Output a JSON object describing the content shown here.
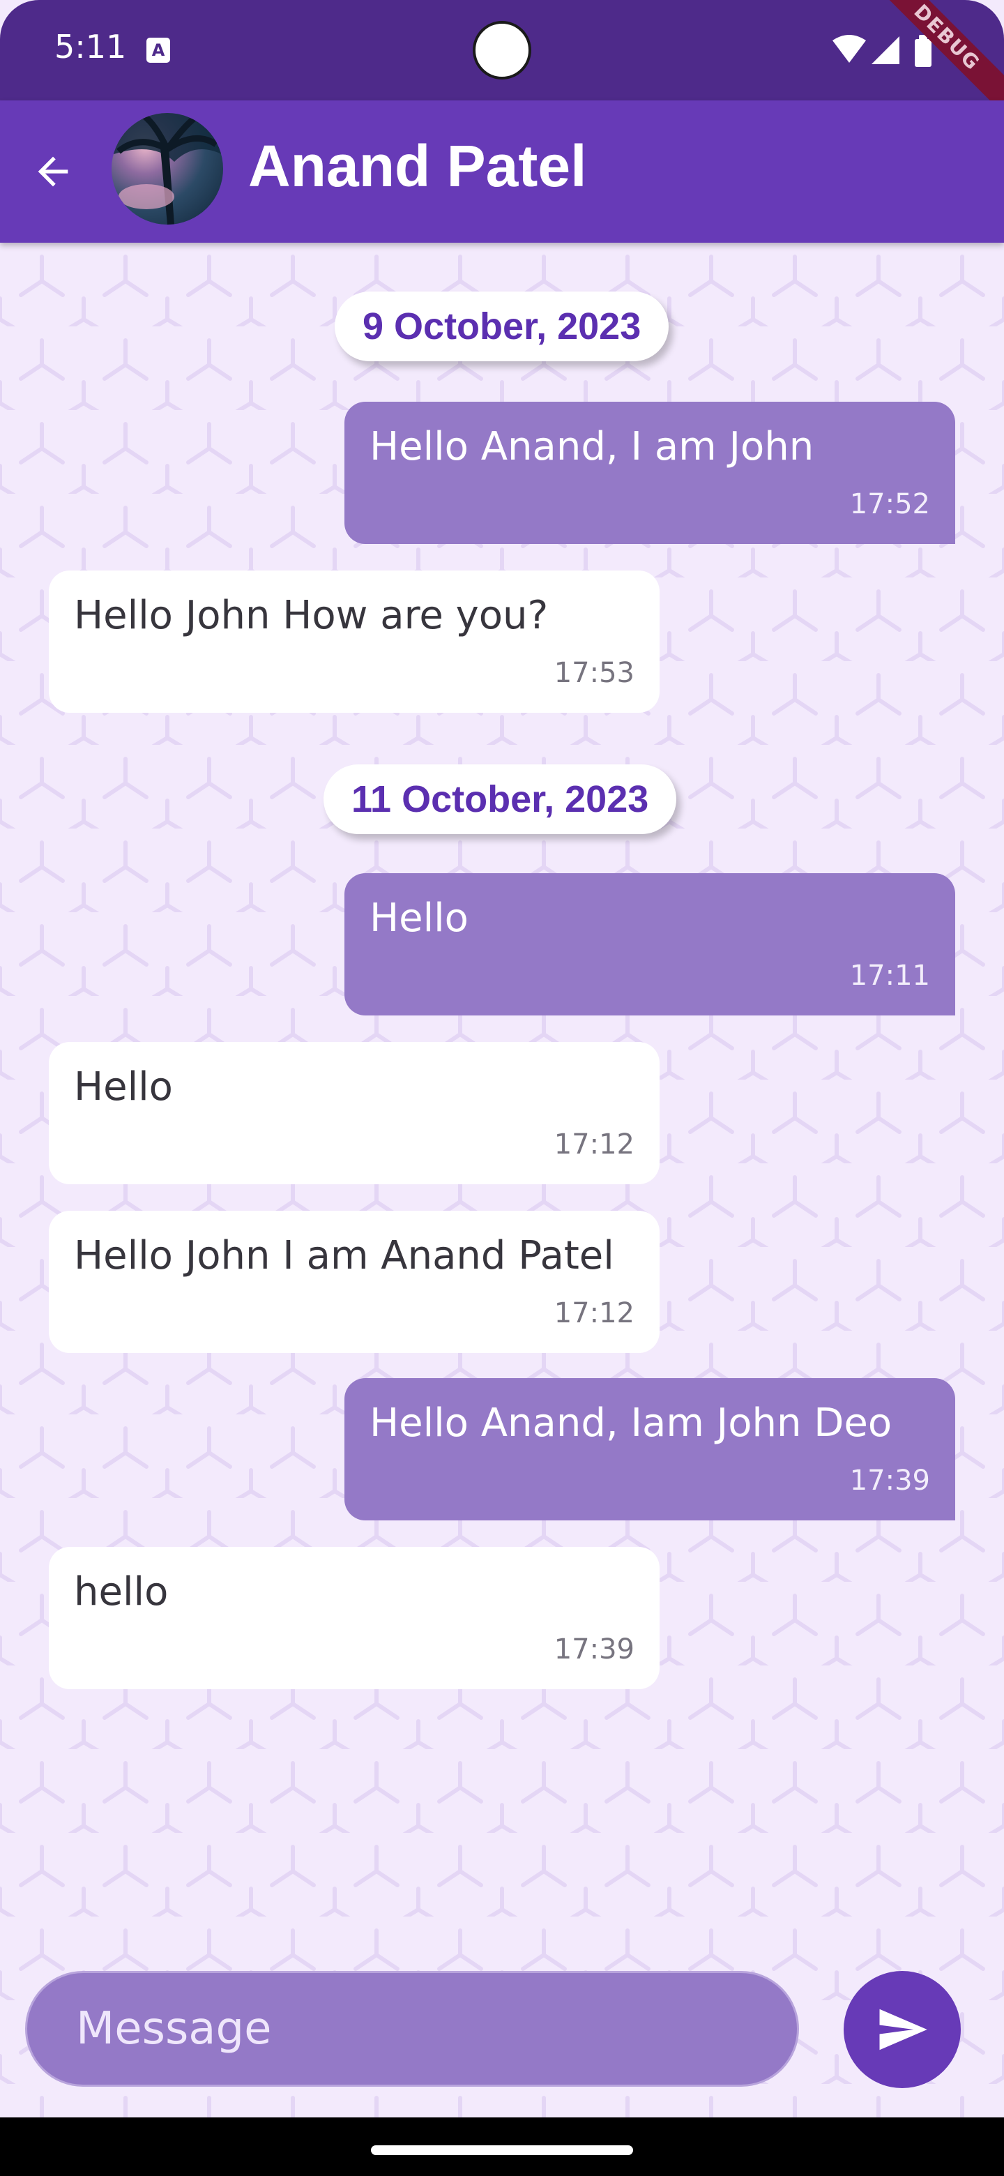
{
  "status_bar": {
    "time": "5:11",
    "icons": [
      "a-notification-icon",
      "wifi-icon",
      "signal-icon",
      "battery-icon"
    ],
    "debug_label": "DEBUG",
    "background": "#4e2a8a"
  },
  "app_bar": {
    "title": "Anand Patel",
    "background": "#673ab7"
  },
  "chat": {
    "dates": [
      "9 October, 2023",
      "11 October, 2023"
    ],
    "messages": [
      {
        "text": "Hello Anand, I am John",
        "time": "17:52",
        "direction": "sent"
      },
      {
        "text": "Hello John How are you?",
        "time": "17:53",
        "direction": "received"
      },
      {
        "text": "Hello",
        "time": "17:11",
        "direction": "sent"
      },
      {
        "text": "Hello",
        "time": "17:12",
        "direction": "received"
      },
      {
        "text": "Hello John I am Anand Patel",
        "time": "17:12",
        "direction": "received"
      },
      {
        "text": "Hello Anand, Iam John Deo",
        "time": "17:39",
        "direction": "sent"
      },
      {
        "text": "hello",
        "time": "17:39",
        "direction": "received"
      }
    ]
  },
  "composer": {
    "placeholder": "Message"
  },
  "colors": {
    "sent_bubble": "#9479c7",
    "received_bubble": "#ffffff",
    "date_text": "#5b2fb0",
    "chat_background": "#f3eafc"
  }
}
